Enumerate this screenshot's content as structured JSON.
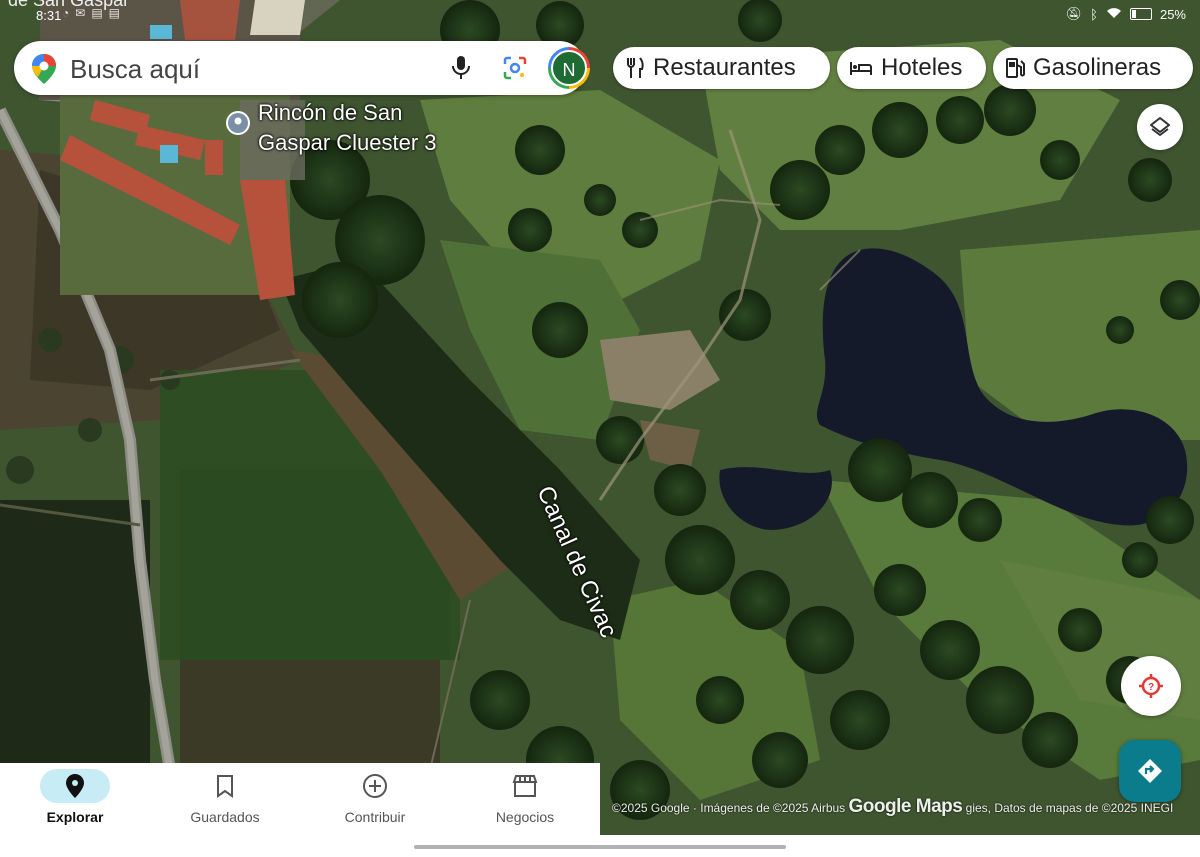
{
  "status_bar": {
    "place_fragment": "de San Gaspar",
    "time": "8:31",
    "battery": "25%",
    "battery_fraction": 0.25
  },
  "search": {
    "placeholder": "Busca aquí",
    "avatar_initial": "N"
  },
  "chips": [
    {
      "label": "Restaurantes",
      "icon": "fork-knife-icon"
    },
    {
      "label": "Hoteles",
      "icon": "bed-icon"
    },
    {
      "label": "Gasolineras",
      "icon": "gas-pump-icon"
    }
  ],
  "map": {
    "place_label_line1": "Rincón de San",
    "place_label_line2": "Gaspar Cluester 3",
    "canal_label": "Canal de Civac",
    "attribution_left": "©2025 Google · Imágenes de ©2025 Airbus",
    "logo": "Google Maps",
    "attribution_right": "gies, Datos de mapas de ©2025 INEGI"
  },
  "controls": {
    "layers": "layers-icon",
    "location": "location-icon",
    "directions": "directions-icon"
  },
  "bottom_nav": [
    {
      "label": "Explorar",
      "icon": "explore-pin-icon",
      "active": true
    },
    {
      "label": "Guardados",
      "icon": "bookmark-icon",
      "active": false
    },
    {
      "label": "Contribuir",
      "icon": "add-circle-icon",
      "active": false
    },
    {
      "label": "Negocios",
      "icon": "store-icon",
      "active": false
    }
  ],
  "colors": {
    "active_nav_bg": "#c7ecf5",
    "directions_bg": "#0a7c8c",
    "location_icon": "#e53935"
  }
}
